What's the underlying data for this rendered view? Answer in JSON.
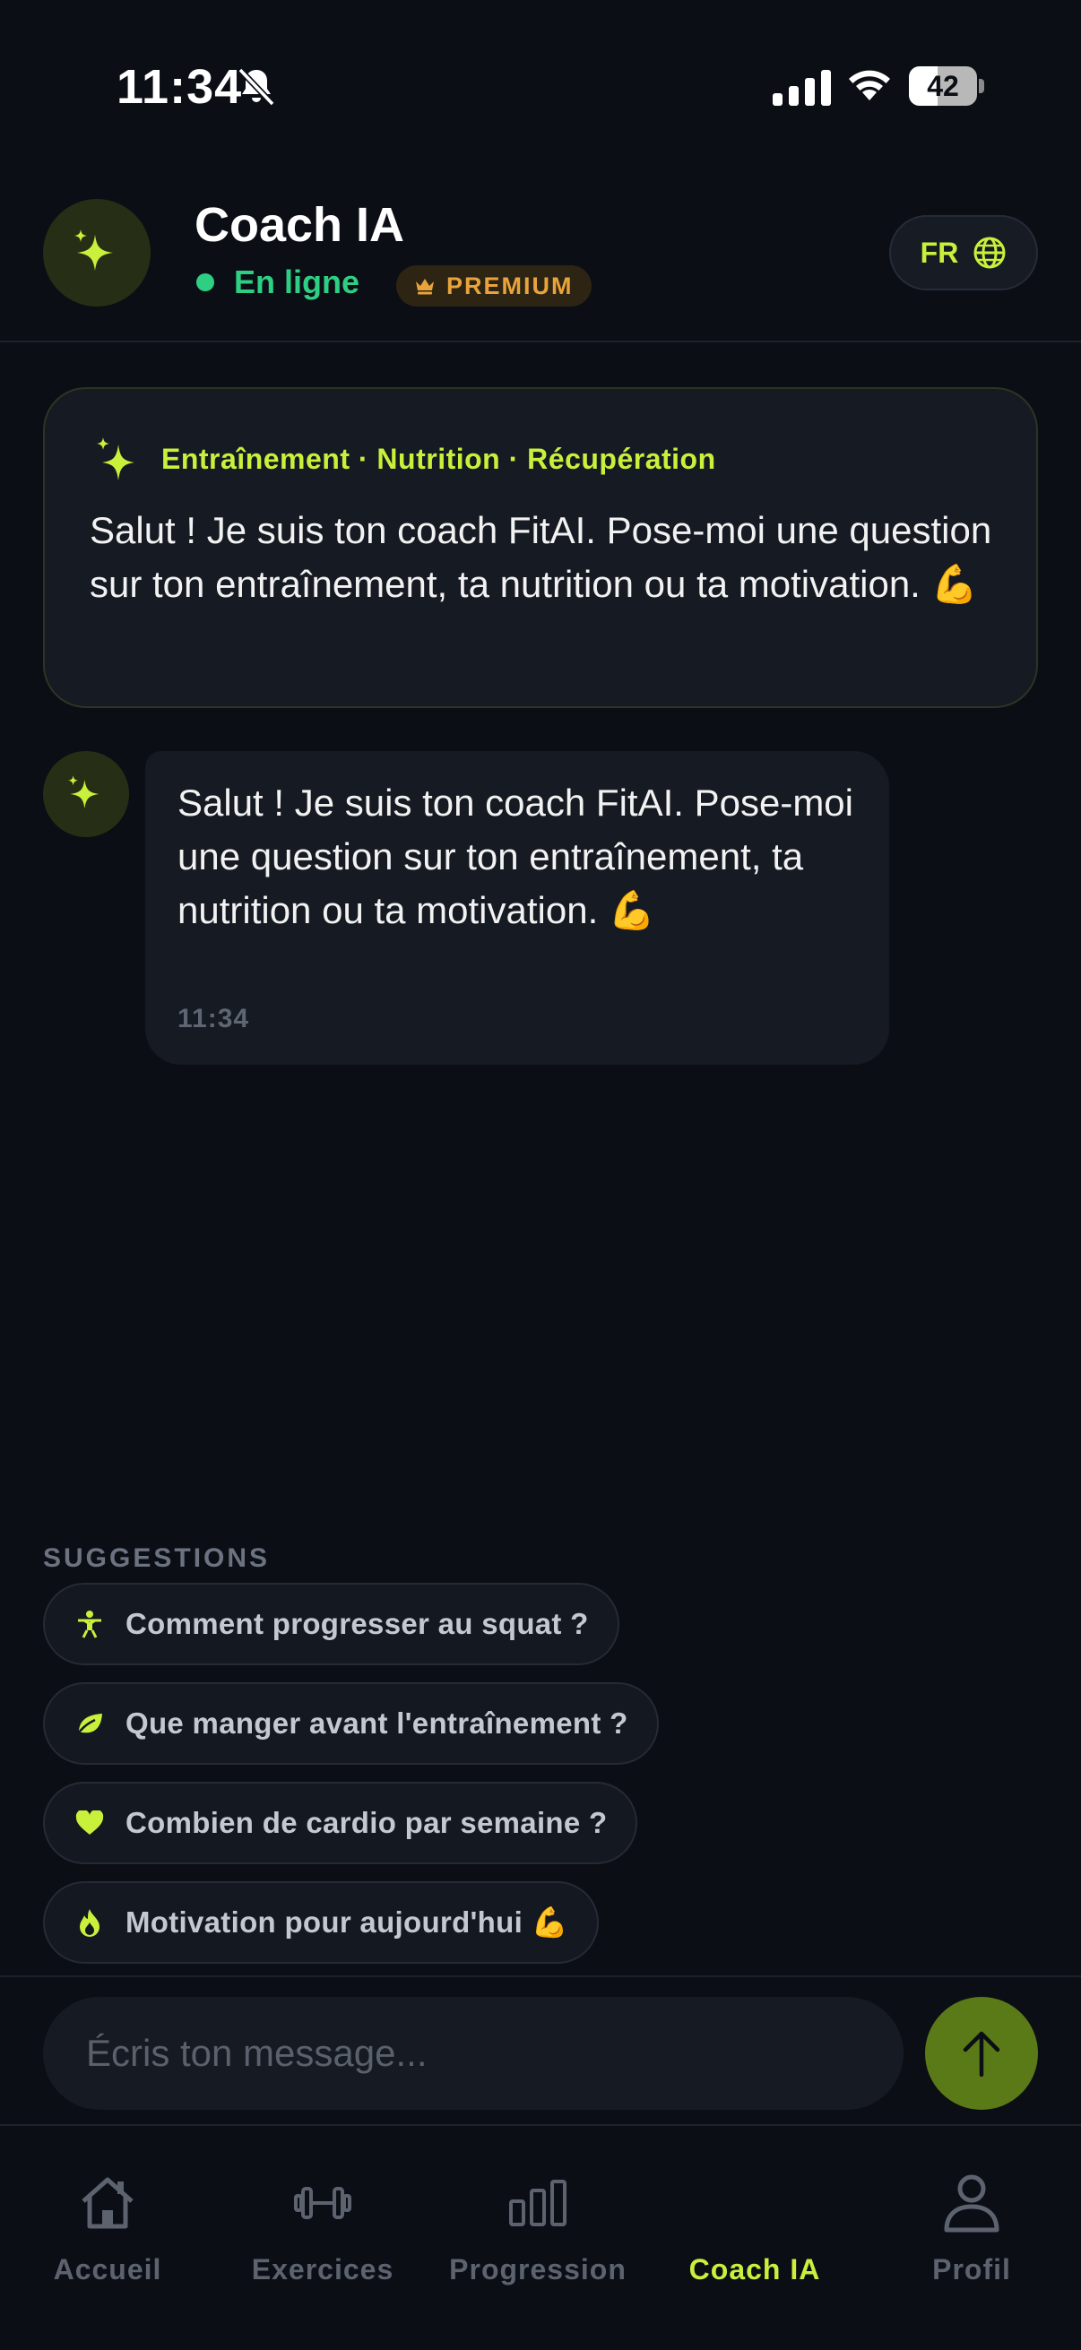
{
  "status_bar": {
    "time": "11:34",
    "battery": "42",
    "icons": [
      "bell-slash-icon",
      "signal-icon",
      "wifi-icon",
      "battery-icon"
    ]
  },
  "header": {
    "title": "Coach IA",
    "status": "En ligne",
    "badge": "PREMIUM",
    "language": "FR",
    "avatar_icon": "sparkles-icon"
  },
  "intro_card": {
    "tags": "Entraînement · Nutrition · Récupération",
    "text": "Salut ! Je suis ton coach FitAI. Pose-moi une question sur ton entraînement, ta nutrition ou ta motivation. 💪"
  },
  "messages": [
    {
      "text": "Salut ! Je suis ton coach FitAI. Pose-moi une question sur ton entraînement, ta nutrition ou ta motivation. 💪",
      "time": "11:34"
    }
  ],
  "suggestions": {
    "label": "SUGGESTIONS",
    "items": [
      {
        "icon": "weightlifter-icon",
        "text": "Comment progresser au squat ?"
      },
      {
        "icon": "leaf-icon",
        "text": "Que manger avant l'entraînement ?"
      },
      {
        "icon": "heart-icon",
        "text": "Combien de cardio par semaine ?"
      },
      {
        "icon": "flame-icon",
        "text": "Motivation pour aujourd'hui 💪"
      }
    ]
  },
  "composer": {
    "placeholder": "Écris ton message...",
    "send_icon": "arrow-up-icon"
  },
  "nav": {
    "items": [
      {
        "label": "Accueil",
        "icon": "home-icon",
        "active": false
      },
      {
        "label": "Exercices",
        "icon": "dumbbell-icon",
        "active": false
      },
      {
        "label": "Progression",
        "icon": "bar-chart-icon",
        "active": false
      },
      {
        "label": "Coach IA",
        "icon": "sparkles-icon",
        "active": true
      },
      {
        "label": "Profil",
        "icon": "user-icon",
        "active": false
      }
    ]
  },
  "colors": {
    "background": "#0b0e15",
    "accent": "#c9f03b",
    "online": "#2ecf83",
    "premium": "#e8a33a",
    "send_button": "#5a7a17"
  }
}
